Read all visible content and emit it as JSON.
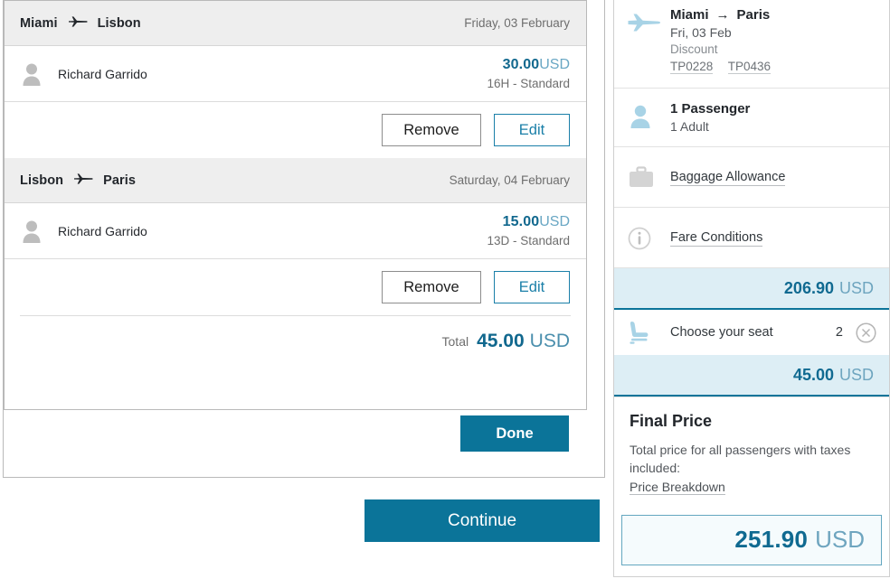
{
  "seat_selection": {
    "legs": [
      {
        "origin": "Miami",
        "destination": "Lisbon",
        "date": "Friday, 03 February",
        "passenger": "Richard Garrido",
        "price_amount": "30.00",
        "price_currency": "USD",
        "seat": "16H - Standard",
        "remove_label": "Remove",
        "edit_label": "Edit"
      },
      {
        "origin": "Lisbon",
        "destination": "Paris",
        "date": "Saturday, 04 February",
        "passenger": "Richard Garrido",
        "price_amount": "15.00",
        "price_currency": "USD",
        "seat": "13D - Standard",
        "remove_label": "Remove",
        "edit_label": "Edit"
      }
    ],
    "total_label": "Total",
    "total_amount": "45.00",
    "total_currency": "USD",
    "done_label": "Done",
    "continue_label": "Continue"
  },
  "sidebar": {
    "itinerary": {
      "origin": "Miami",
      "arrow": "→",
      "destination": "Paris",
      "date": "Fri, 03 Feb",
      "fare": "Discount",
      "flights": [
        "TP0228",
        "TP0436"
      ]
    },
    "passengers": {
      "title": "1 Passenger",
      "detail": "1 Adult"
    },
    "baggage_link": "Baggage Allowance",
    "fare_conditions_link": "Fare Conditions",
    "fare_price": {
      "amount": "206.90",
      "currency": "USD"
    },
    "seat_item": {
      "label": "Choose your seat",
      "count": "2"
    },
    "seat_price": {
      "amount": "45.00",
      "currency": "USD"
    },
    "final": {
      "title": "Final Price",
      "description": "Total price for all passengers with taxes included:",
      "breakdown_link": "Price Breakdown",
      "amount": "251.90",
      "currency": "USD"
    }
  },
  "colors": {
    "accent": "#0b7499",
    "price": "#106a91",
    "currency_muted": "#6ea5bf",
    "band_bg": "#ddeef5",
    "header_bg": "#eeeeee",
    "icon_blue": "#a8d3e6",
    "icon_gray": "#cfcfcf"
  }
}
